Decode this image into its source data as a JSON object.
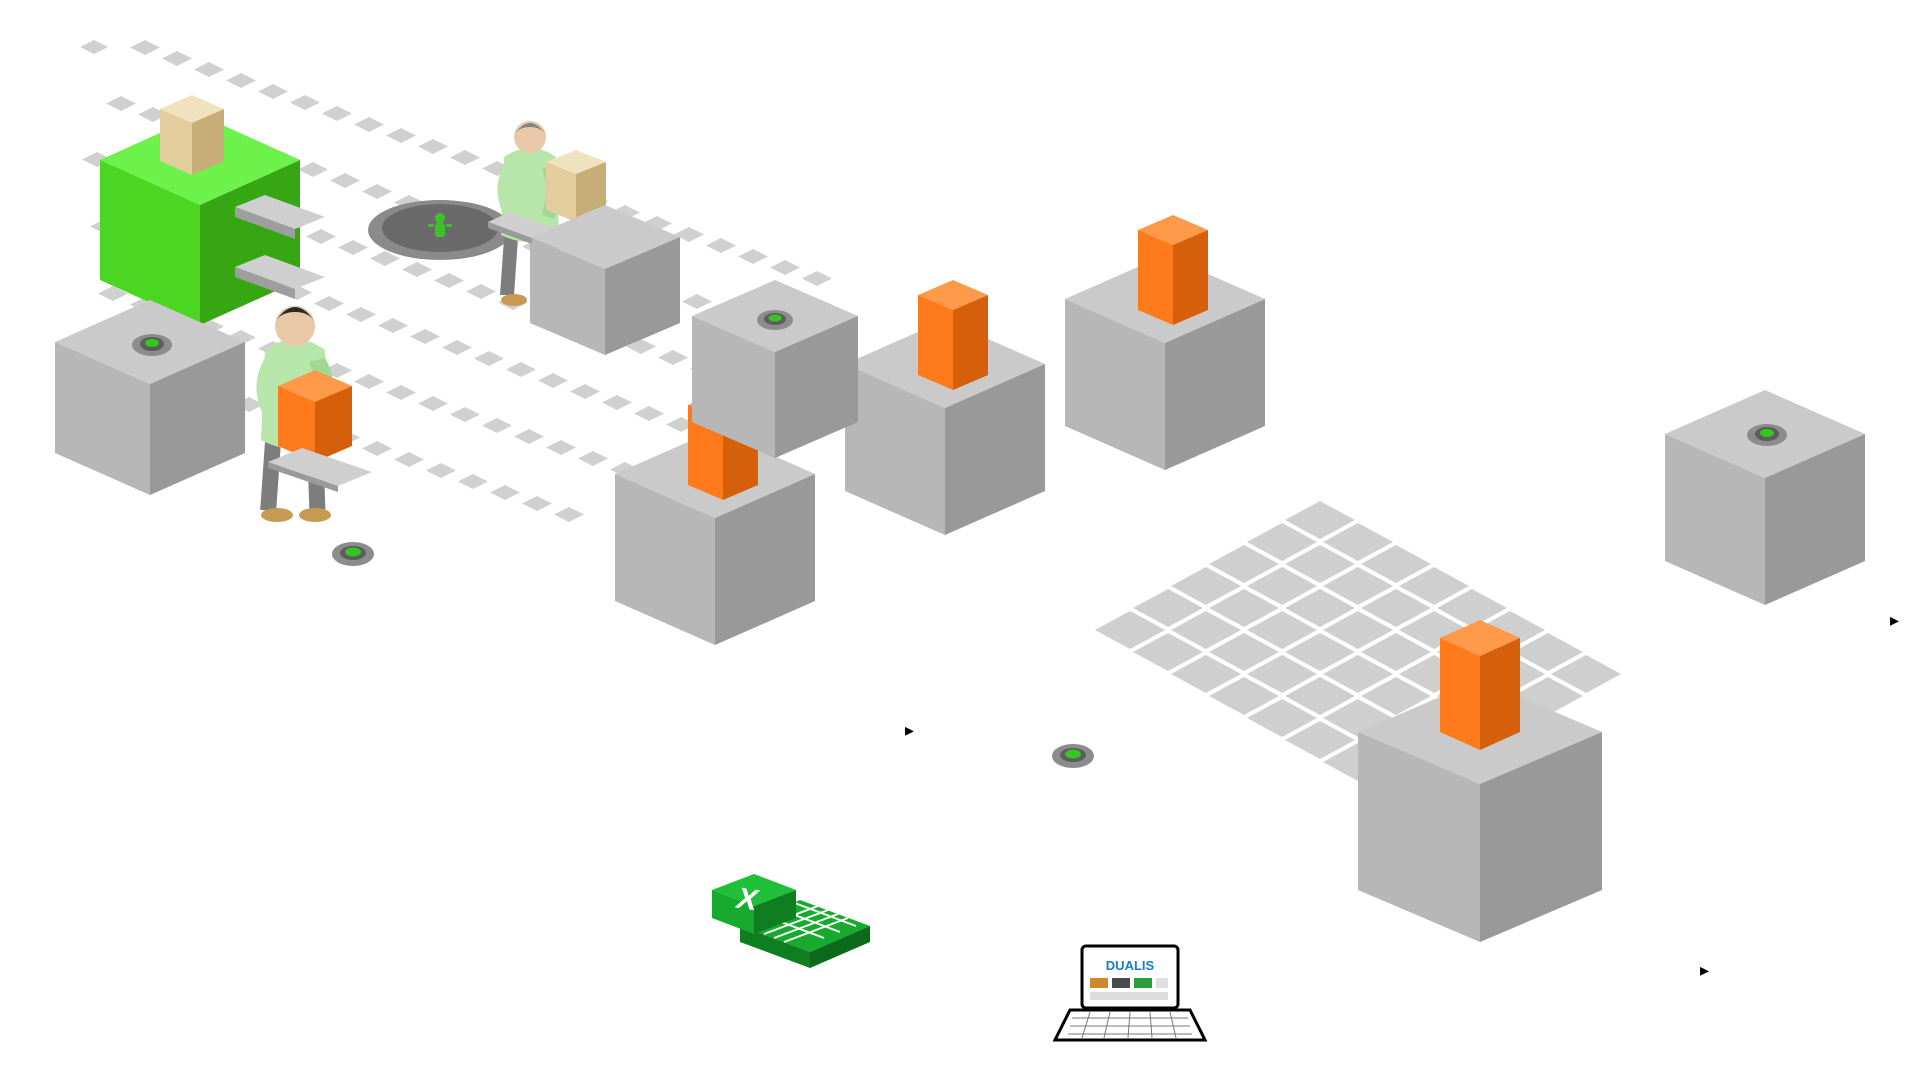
{
  "scene": {
    "objects": {
      "greenCube": {
        "name": "green-machine-cube",
        "type": "cube",
        "fill": "#4ad621",
        "shade": "#36a712",
        "top": "#6cf24a",
        "interactable": true
      },
      "grayWorkstation": {
        "name": "gray-workstation-cube",
        "type": "cube",
        "fill": "#b7b7b7",
        "shade": "#999999",
        "top": "#cacaca",
        "interactable": true
      },
      "orangeItem": {
        "name": "orange-product-box",
        "type": "box",
        "fill": "#ff7a1a",
        "shade": "#d55f0a",
        "top": "#ff9a4a",
        "interactable": true
      },
      "beigeItem": {
        "name": "beige-product-box",
        "type": "box",
        "fill": "#e4cd9d",
        "shade": "#c7ad77",
        "top": "#f1e2bf",
        "interactable": true
      },
      "pathTile": {
        "name": "floor-path-tile",
        "type": "tile",
        "fill": "#d0d0d0",
        "interactable": false
      },
      "floorGridTile": {
        "name": "floor-grid-tile",
        "type": "tile",
        "fill": "#cfcfcf",
        "interactable": false
      },
      "greenButton": {
        "name": "floor-green-button",
        "type": "button",
        "fill": "#34c71f",
        "ring": "#8c8c8c",
        "interactable": true
      },
      "workerDisc": {
        "name": "worker-spawn-disc",
        "type": "disc",
        "fill": "#6a6a6a",
        "inner": "#3fc12a",
        "interactable": true
      },
      "workerGreen": {
        "name": "worker-green-shirt",
        "type": "worker",
        "shirt": "#b6e6a9",
        "pants": "#7d7d7d",
        "hair": "#2a2a2a",
        "interactable": true
      },
      "excelIcon": {
        "name": "excel-export-icon",
        "type": "icon",
        "fill": "#17aa2f",
        "interactable": true
      },
      "laptopIcon": {
        "name": "control-laptop-icon",
        "type": "icon",
        "brand": "DUALIS",
        "interactable": true
      },
      "navArrow": {
        "name": "nav-arrow",
        "type": "arrow",
        "interactable": true
      }
    }
  },
  "iconText": {
    "excelLetter": "X",
    "laptopBrand": "DUALIS"
  }
}
